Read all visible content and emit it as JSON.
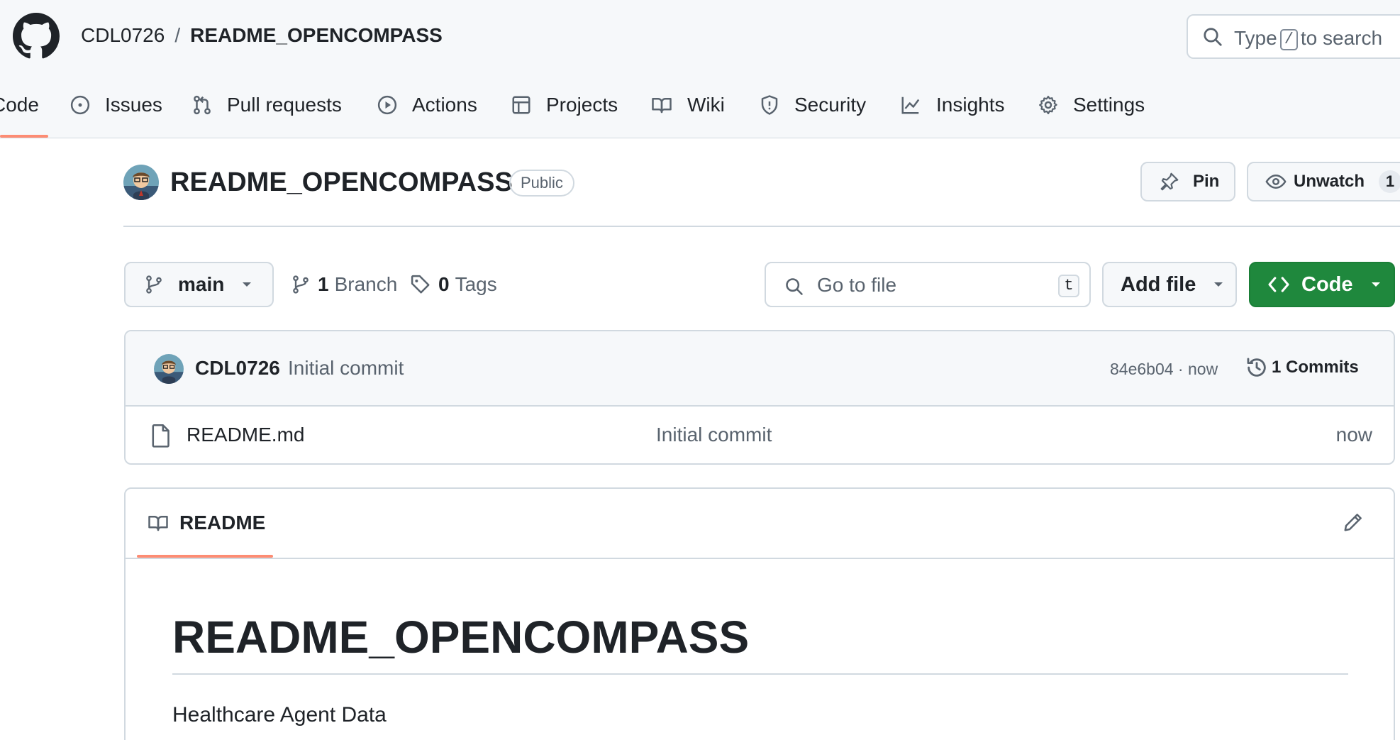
{
  "header": {
    "owner": "CDL0726",
    "separator": "/",
    "repo": "README_OPENCOMPASS",
    "search": {
      "prefix": "Type",
      "key": "/",
      "suffix": "to search"
    }
  },
  "nav": {
    "tabs": [
      {
        "label": "Code",
        "icon": "code-icon",
        "selected": true
      },
      {
        "label": "Issues",
        "icon": "issue-icon"
      },
      {
        "label": "Pull requests",
        "icon": "pull-request-icon"
      },
      {
        "label": "Actions",
        "icon": "play-icon"
      },
      {
        "label": "Projects",
        "icon": "table-icon"
      },
      {
        "label": "Wiki",
        "icon": "book-icon"
      },
      {
        "label": "Security",
        "icon": "shield-icon"
      },
      {
        "label": "Insights",
        "icon": "graph-icon"
      },
      {
        "label": "Settings",
        "icon": "gear-icon"
      }
    ]
  },
  "repo_header": {
    "name": "README_OPENCOMPASS",
    "visibility": "Public",
    "pin_label": "Pin",
    "unwatch_label": "Unwatch",
    "watch_count": "1"
  },
  "toolbar": {
    "branch": "main",
    "branch_count": "1",
    "branch_label": "Branch",
    "tag_count": "0",
    "tag_label": "Tags",
    "goto_placeholder": "Go to file",
    "goto_key": "t",
    "add_file_label": "Add file",
    "code_label": "Code"
  },
  "latest_commit": {
    "author": "CDL0726",
    "message": "Initial commit",
    "hash_time": "84e6b04 · now",
    "commits_label": "1 Commits"
  },
  "files": [
    {
      "name": "README.md",
      "message": "Initial commit",
      "time": "now"
    }
  ],
  "readme": {
    "tab_label": "README",
    "title": "README_OPENCOMPASS",
    "text": "Healthcare Agent Data"
  },
  "colors": {
    "accent_underline": "#fd8c73",
    "primary_button": "#1f883d"
  }
}
